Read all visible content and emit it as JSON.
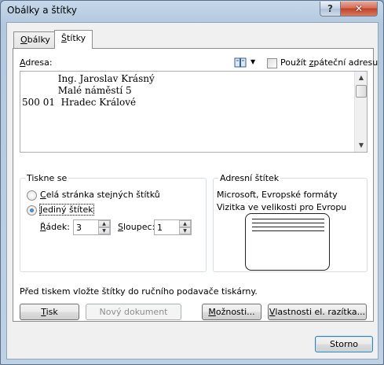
{
  "window": {
    "title": "Obálky a štítky",
    "help_glyph": "?",
    "close_glyph": "✕"
  },
  "tabs": [
    {
      "label": "Obálky",
      "mnemonic": "O",
      "rest": "bálky"
    },
    {
      "label": "Štítky",
      "mnemonic": "Š",
      "rest": "títky"
    }
  ],
  "address": {
    "label_mn": "A",
    "label_rest": "dresa:",
    "lines": [
      "            Ing. Jaroslav Krásný",
      "            Malé náměstí 5",
      "500 01  Hradec Králové"
    ],
    "use_return": {
      "pre": "Použít ",
      "mn": "z",
      "post": "páteční adresu",
      "checked": false
    }
  },
  "print_group": {
    "title": "Tiskne se",
    "full_page": {
      "mn": "C",
      "rest": "elá stránka stejných štítků",
      "selected": false
    },
    "single": {
      "mn": "J",
      "rest": "ediný štítek",
      "selected": true
    },
    "row": {
      "mn": "Ř",
      "rest": "ádek:",
      "value": "3"
    },
    "column": {
      "mn": "S",
      "rest": "loupec:",
      "value": "1"
    }
  },
  "label_group": {
    "title": "Adresní štítek",
    "line1": "Microsoft, Evropské formáty",
    "line2": "Vizitka ve velikosti pro Evropu"
  },
  "hint": "Před tiskem vložte štítky do ručního podavače tiskárny.",
  "buttons": {
    "print": {
      "mn": "T",
      "rest": "isk"
    },
    "new_doc": "Nový dokument",
    "options": {
      "mn": "M",
      "rest": "ožnosti..."
    },
    "stamp": {
      "mn": "V",
      "rest": "lastnosti el. razítka..."
    },
    "cancel": "Storno"
  }
}
